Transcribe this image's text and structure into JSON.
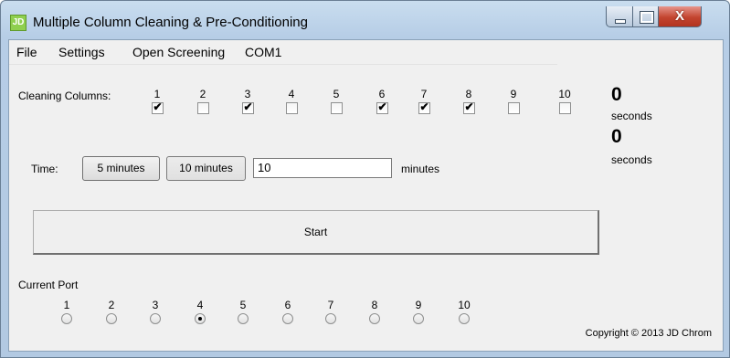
{
  "window": {
    "title": "Multiple Column Cleaning & Pre-Conditioning",
    "icon_text": "JD",
    "controls": {
      "close_glyph": "X"
    }
  },
  "menu": {
    "items": [
      "File",
      "Settings",
      "Open Screening",
      "COM1"
    ]
  },
  "cleaning": {
    "label": "Cleaning Columns:",
    "columns": [
      {
        "label": "1",
        "checked": true
      },
      {
        "label": "2",
        "checked": false
      },
      {
        "label": "3",
        "checked": true
      },
      {
        "label": "4",
        "checked": false
      },
      {
        "label": "5",
        "checked": false
      },
      {
        "label": "6",
        "checked": true
      },
      {
        "label": "7",
        "checked": true
      },
      {
        "label": "8",
        "checked": true
      },
      {
        "label": "9",
        "checked": false
      },
      {
        "label": "10",
        "checked": false
      }
    ]
  },
  "timers": {
    "first_value": "0",
    "first_unit": "seconds",
    "second_value": "0",
    "second_unit": "seconds"
  },
  "time": {
    "label": "Time:",
    "btn_5": "5 minutes",
    "btn_10": "10 minutes",
    "value": "10",
    "unit": "minutes"
  },
  "start_label": "Start",
  "port": {
    "label": "Current Port",
    "options": [
      "1",
      "2",
      "3",
      "4",
      "5",
      "6",
      "7",
      "8",
      "9",
      "10"
    ],
    "selected": "4"
  },
  "copyright": "Copyright © 2013 JD Chrom"
}
